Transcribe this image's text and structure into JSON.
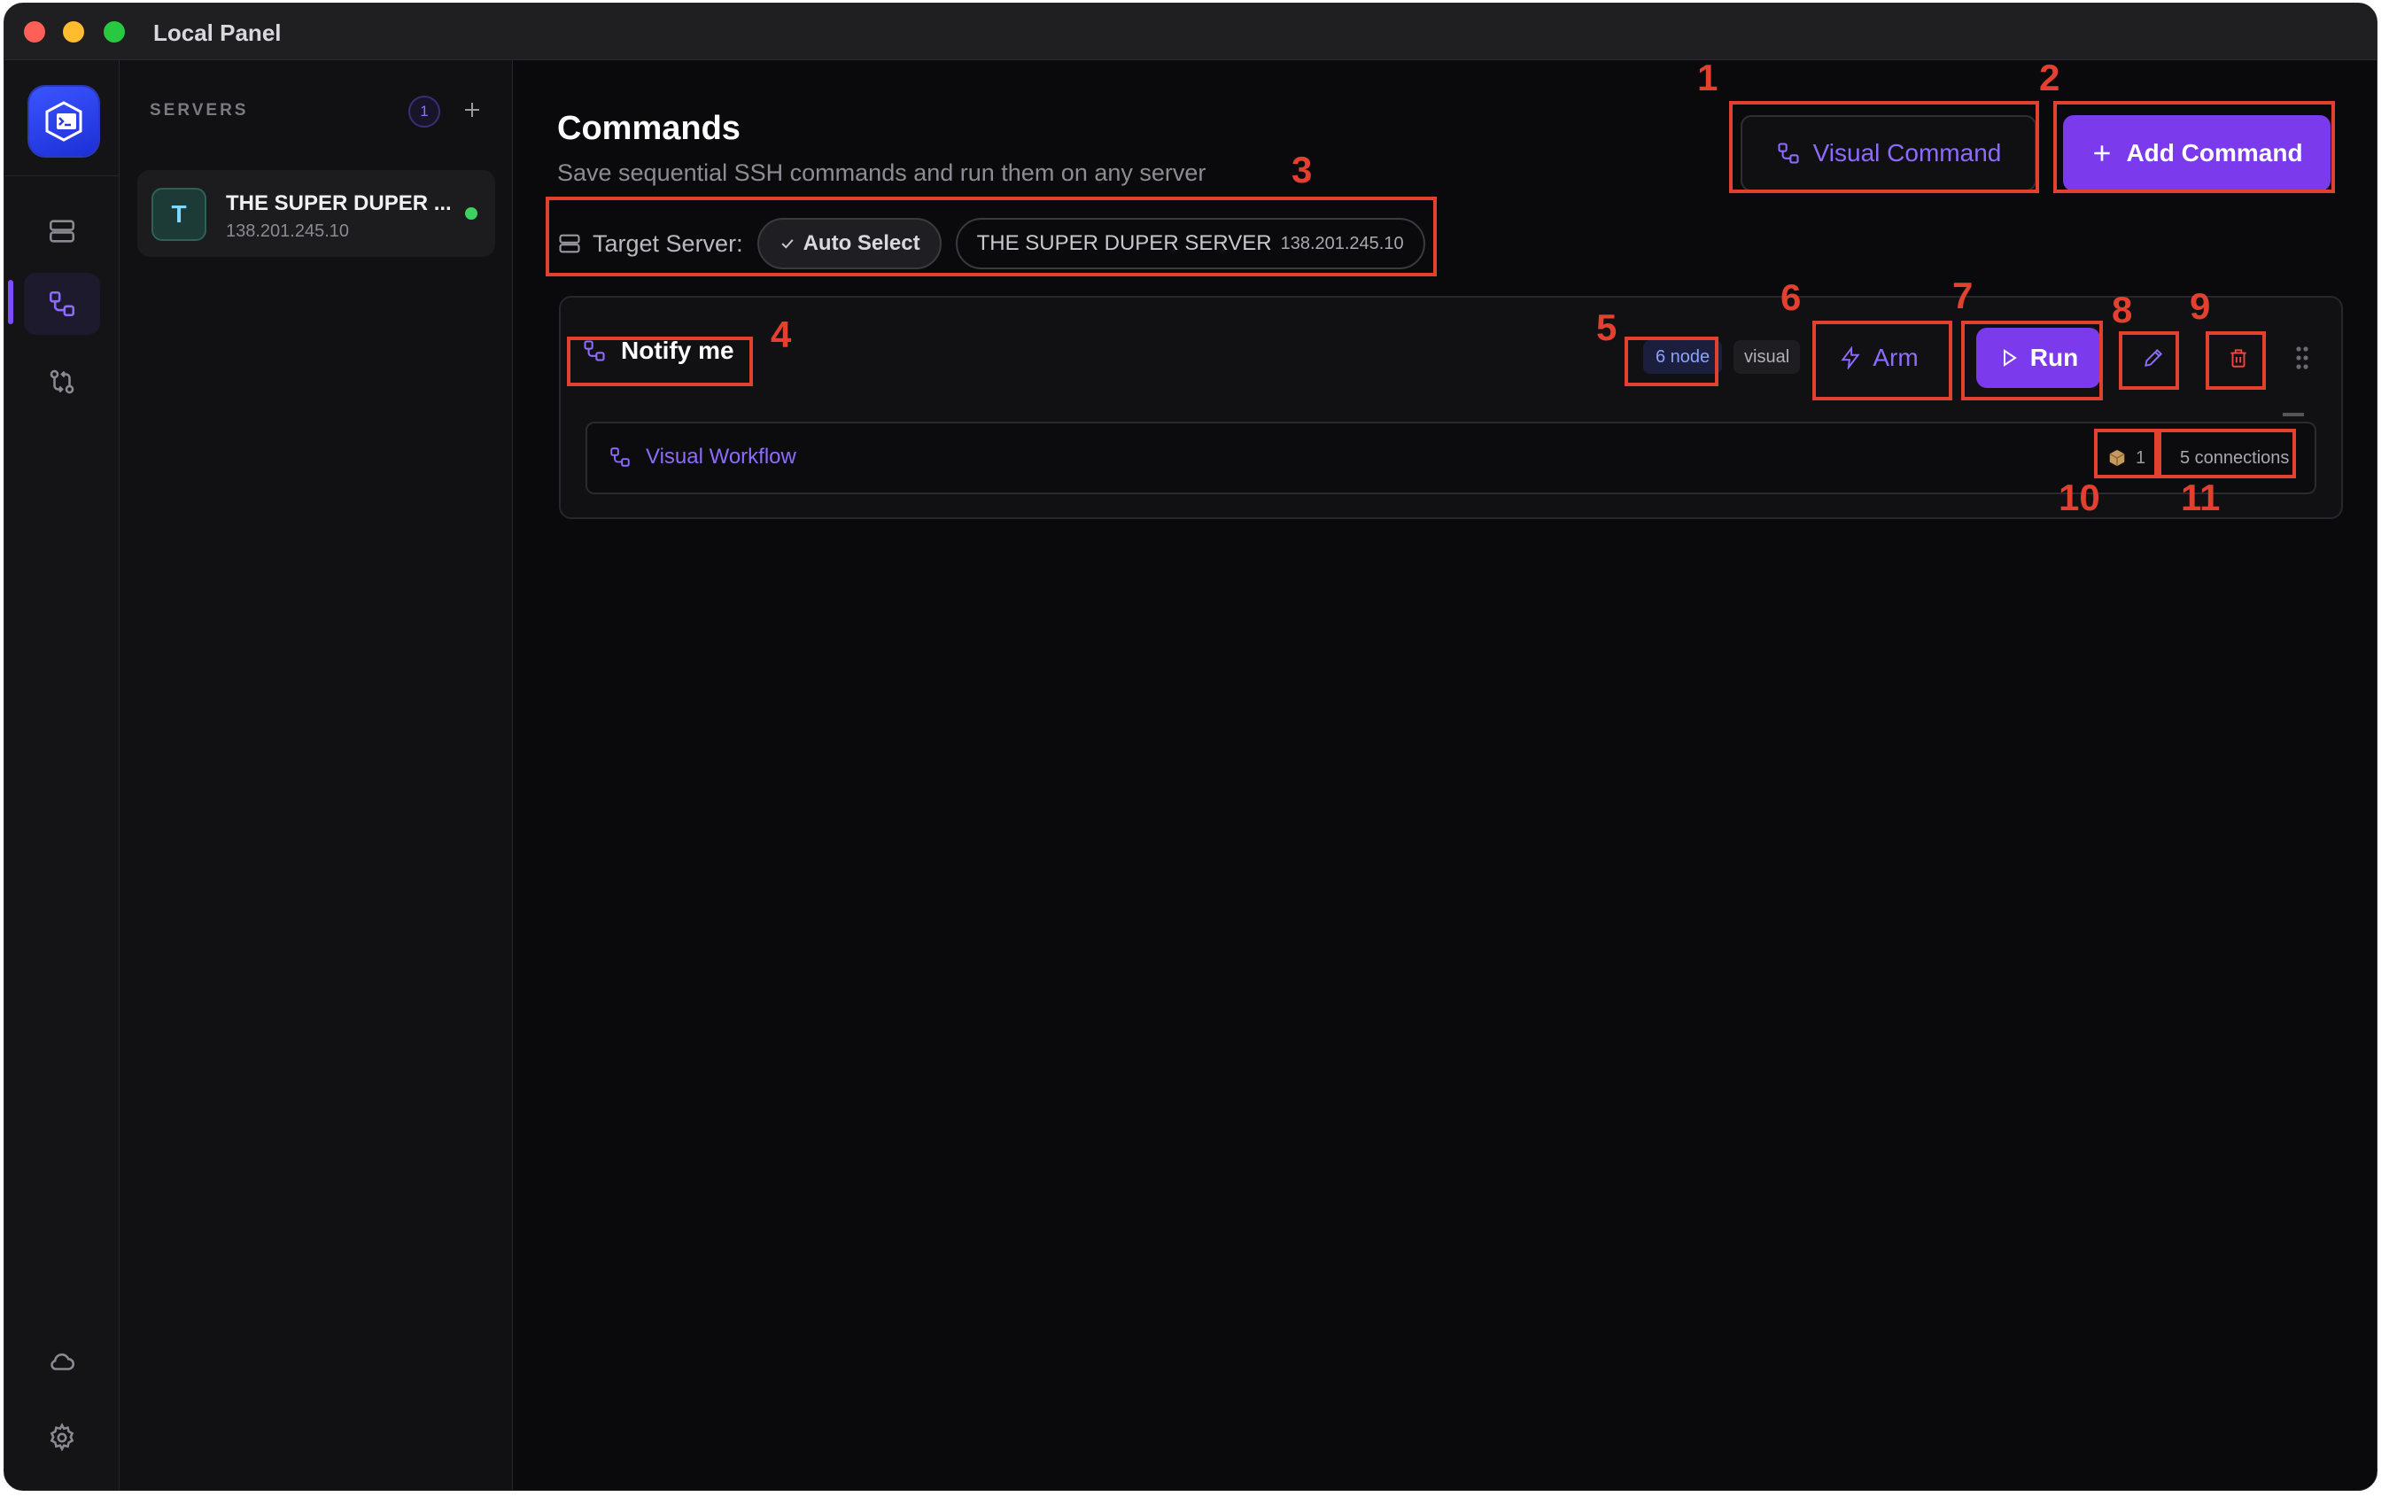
{
  "window": {
    "title": "Local Panel"
  },
  "servers_panel": {
    "heading": "SERVERS",
    "count": "1",
    "add_symbol": "+",
    "items": [
      {
        "initial": "T",
        "name": "THE SUPER DUPER ...",
        "ip": "138.201.245.10",
        "status": "online"
      }
    ]
  },
  "main": {
    "title": "Commands",
    "subtitle": "Save sequential SSH commands and run them on any server",
    "visual_command_label": "Visual Command",
    "add_command_label": "Add Command",
    "target": {
      "label": "Target Server:",
      "auto_select_label": "Auto Select",
      "server_name": "THE SUPER DUPER SERVER",
      "server_ip": "138.201.245.10"
    },
    "commands": [
      {
        "name": "Notify me",
        "node_tag": "6 node",
        "type_tag": "visual",
        "arm_label": "Arm",
        "run_label": "Run",
        "workflow_label": "Visual Workflow",
        "step_count": "1",
        "connections": "5 connections"
      }
    ]
  },
  "annotations": [
    "1",
    "2",
    "3",
    "4",
    "5",
    "6",
    "7",
    "8",
    "9",
    "10",
    "11"
  ],
  "colors": {
    "accent": "#7c3aed",
    "annotation": "#e2412f",
    "online": "#3ed160",
    "bg": "#0a0a0c"
  },
  "icons": [
    "app-logo-icon",
    "server-stack-icon",
    "workflow-icon",
    "git-compare-icon",
    "cloud-icon",
    "gear-icon",
    "plus-icon",
    "check-icon",
    "bolt-icon",
    "play-icon",
    "pencil-icon",
    "trash-icon",
    "drag-handle-icon",
    "package-icon"
  ]
}
